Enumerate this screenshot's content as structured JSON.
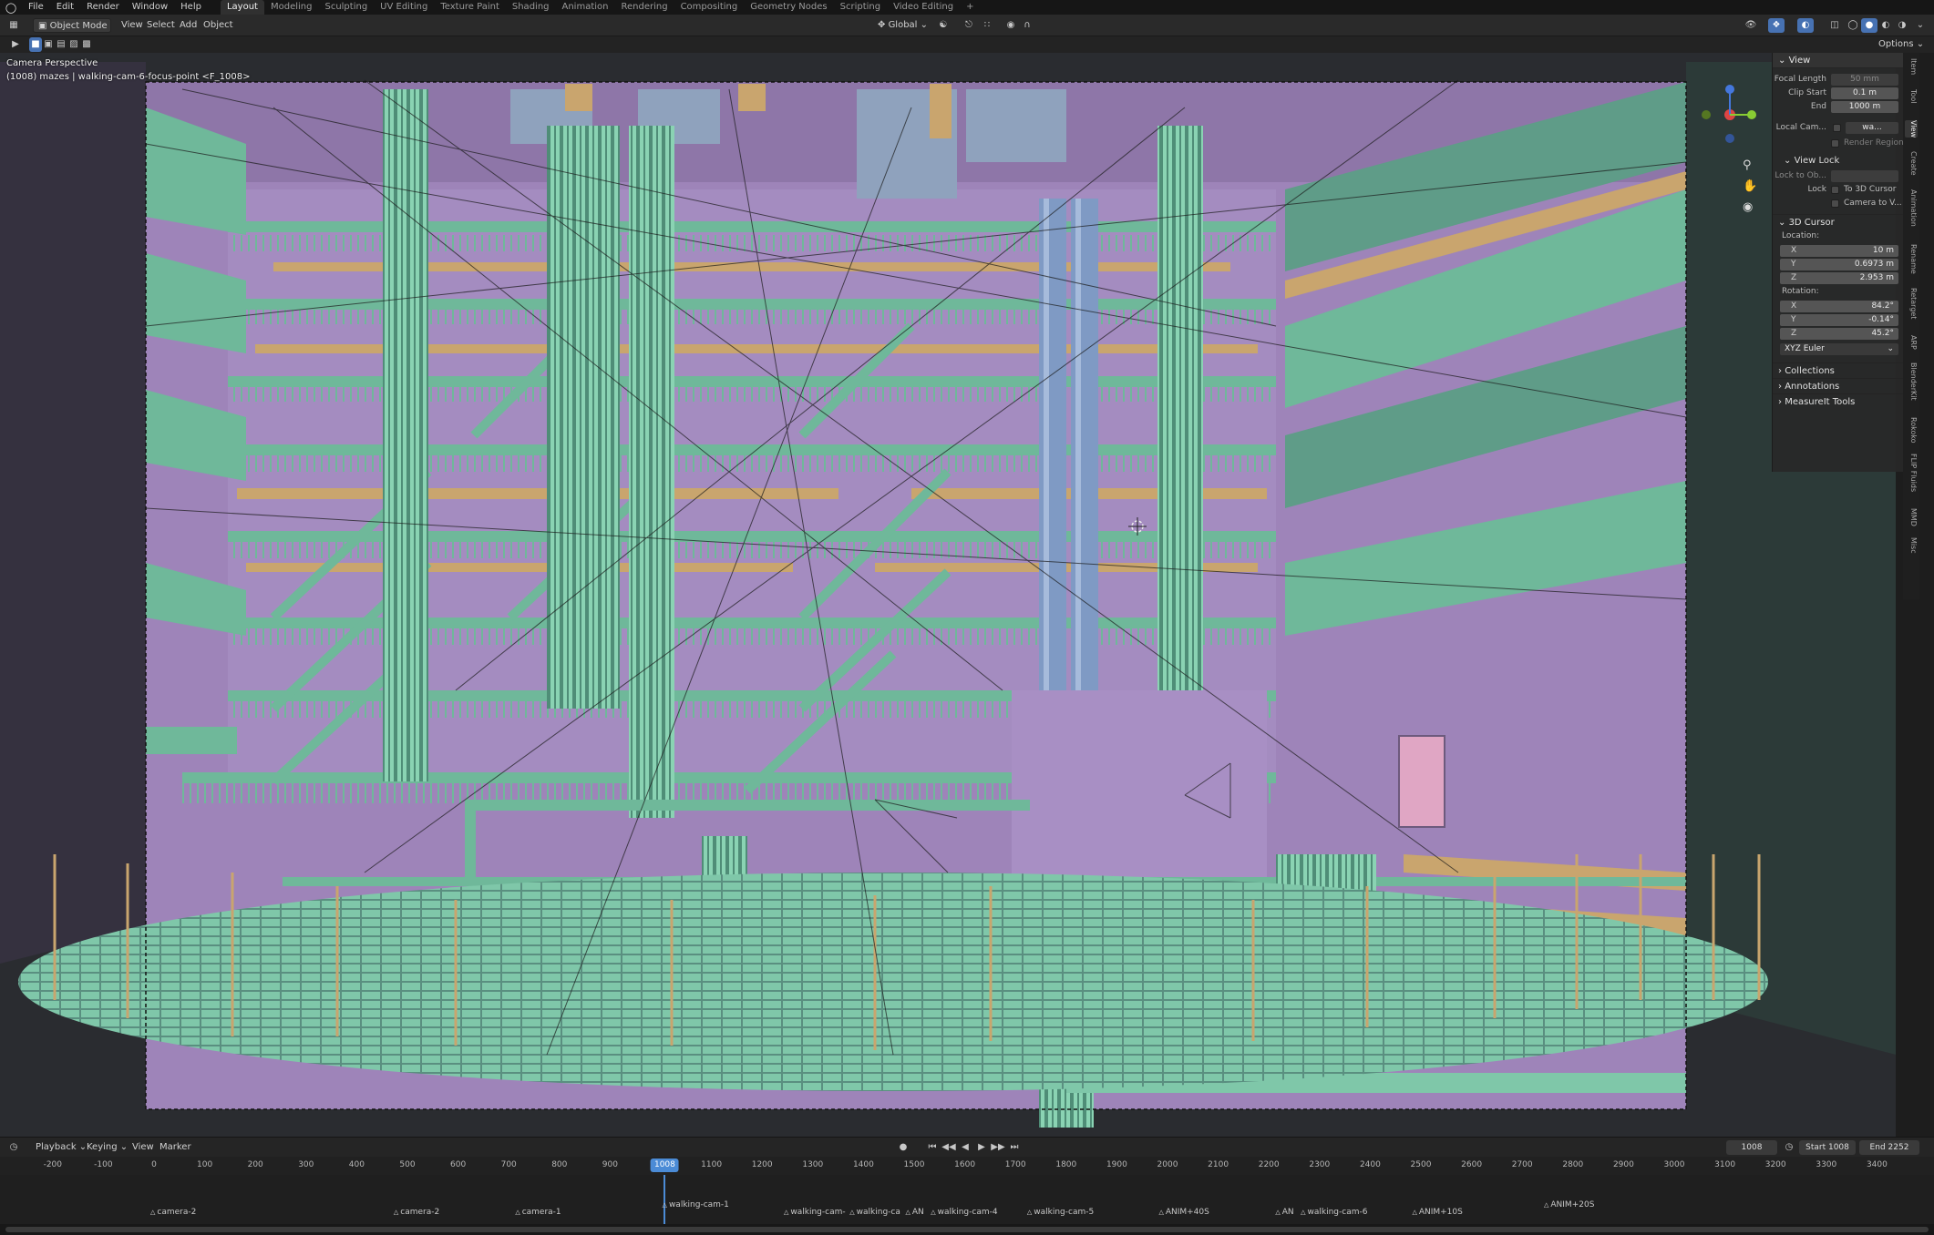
{
  "topbar": {
    "menus": [
      "File",
      "Edit",
      "Render",
      "Window",
      "Help"
    ],
    "workspaces": [
      "Layout",
      "Modeling",
      "Sculpting",
      "UV Editing",
      "Texture Paint",
      "Shading",
      "Animation",
      "Rendering",
      "Compositing",
      "Geometry Nodes",
      "Scripting",
      "Video Editing"
    ],
    "active_workspace": "Layout",
    "add_workspace": "+"
  },
  "header": {
    "mode": "Object Mode",
    "menus": [
      "View",
      "Select",
      "Add",
      "Object"
    ],
    "orientation": "Global",
    "options": "Options"
  },
  "viewport": {
    "camera_label": "Camera Perspective",
    "object_label": "(1008) mazes | walking-cam-6-focus-point <F_1008>"
  },
  "npanel": {
    "view_section": "View",
    "focal_length_label": "Focal Length",
    "focal_length": "50 mm",
    "clip_start_label": "Clip Start",
    "clip_start": "0.1 m",
    "end_label": "End",
    "clip_end": "1000 m",
    "local_camera_label": "Local Cam...",
    "local_camera_value": "wa...",
    "render_region": "Render Region",
    "view_lock": "View Lock",
    "lock_to_object_label": "Lock to Ob...",
    "lock_label": "Lock",
    "to_3d_cursor": "To 3D Cursor",
    "camera_to_view": "Camera to V...",
    "cursor_section": "3D Cursor",
    "location_label": "Location:",
    "loc_x": "10 m",
    "loc_y": "0.6973 m",
    "loc_z": "2.953 m",
    "rotation_label": "Rotation:",
    "rot_x": "84.2°",
    "rot_y": "-0.14°",
    "rot_z": "45.2°",
    "rotation_mode": "XYZ Euler",
    "collections": "Collections",
    "annotations": "Annotations",
    "measureit": "MeasureIt Tools",
    "side_tabs": [
      "Item",
      "Tool",
      "View",
      "Create",
      "Animation",
      "Rename",
      "Retarget",
      "ARP",
      "BlenderKit",
      "Rokoko",
      "FLIP Fluids",
      "MMD",
      "Misc"
    ],
    "active_side_tab": "View"
  },
  "timeline": {
    "playback": "Playback",
    "keying": "Keying",
    "view": "View",
    "marker": "Marker",
    "current_frame": "1008",
    "start_label": "Start",
    "start": "1008",
    "end_label": "End",
    "end": "2252",
    "ticks": [
      -200,
      -100,
      0,
      100,
      200,
      300,
      400,
      500,
      600,
      700,
      800,
      900,
      1000,
      1100,
      1200,
      1300,
      1400,
      1500,
      1600,
      1700,
      1800,
      1900,
      2000,
      2100,
      2200,
      2300,
      2400,
      2500,
      2600,
      2700,
      2800,
      2900,
      3000,
      3100,
      3200,
      3300,
      3400
    ],
    "markers": [
      {
        "label": "camera-2",
        "frame": 0,
        "row": 1
      },
      {
        "label": "camera-2",
        "frame": 480,
        "row": 1
      },
      {
        "label": "camera-1",
        "frame": 720,
        "row": 1
      },
      {
        "label": "walking-cam-1",
        "frame": 1010,
        "row": 0
      },
      {
        "label": "walking-cam-",
        "frame": 1250,
        "row": 1
      },
      {
        "label": "walking-ca",
        "frame": 1380,
        "row": 1
      },
      {
        "label": "AN",
        "frame": 1490,
        "row": 1
      },
      {
        "label": "walking-cam-4",
        "frame": 1540,
        "row": 1
      },
      {
        "label": "walking-cam-5",
        "frame": 1730,
        "row": 1
      },
      {
        "label": "ANIM+40S",
        "frame": 1990,
        "row": 1
      },
      {
        "label": "AN",
        "frame": 2220,
        "row": 1
      },
      {
        "label": "walking-cam-6",
        "frame": 2270,
        "row": 1
      },
      {
        "label": "ANIM+10S",
        "frame": 2490,
        "row": 1
      },
      {
        "label": "ANIM+20S",
        "frame": 2750,
        "row": 0
      }
    ]
  },
  "colors": {
    "walls": "#9e84b9",
    "rails": "#6fb89a",
    "floor_tiles": "#7fc7a9",
    "planks": "#c9a56e",
    "selection": "#4772b3",
    "playhead": "#4b8bd6"
  }
}
